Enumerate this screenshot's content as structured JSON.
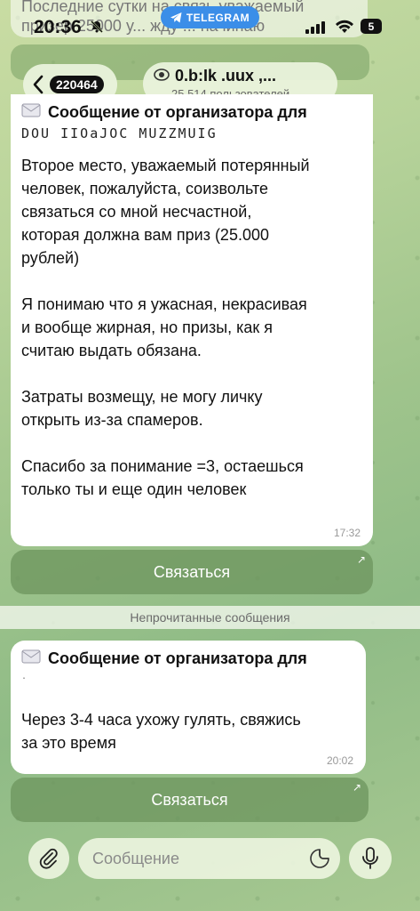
{
  "status_bar": {
    "time": "20:36",
    "app_pill": "TELEGRAM",
    "battery": "5"
  },
  "background_preview": {
    "text": "Последние сутки на связь уважаемый призер 25000 у... жду ... начинаю"
  },
  "header": {
    "back_badge": "220464",
    "title": "0.b:Ik .uux ,...",
    "subtitle": "25 514 пользователей"
  },
  "messages": [
    {
      "title": "Сообщение от организатора для",
      "scribble": "DOU IIOaJOC   MUZZMUIG",
      "text": "Второе место, уважаемый потерянный\nчеловек, пожалуйста, соизвольте\nсвязаться со мной несчастной,\nкоторая должна вам приз (25.000\nрублей)\n\nЯ понимаю что я ужасная, некрасивая\nи вообще жирная, но призы, как я\nсчитаю выдать обязана.\n\nЗатраты возмещу, не могу личку\nоткрыть из-за спамеров.\n\nСпасибо за понимание =3, остаешься\nтолько ты и еще один человек",
      "time": "17:32",
      "button": "Связаться"
    },
    {
      "title": "Сообщение от организатора для",
      "scribble": ".",
      "text": "Через 3-4 часа ухожу гулять, свяжись\nза это время",
      "time": "20:02",
      "button": "Связаться"
    }
  ],
  "unread_divider": "Непрочитанные сообщения",
  "composer": {
    "placeholder": "Сообщение"
  }
}
